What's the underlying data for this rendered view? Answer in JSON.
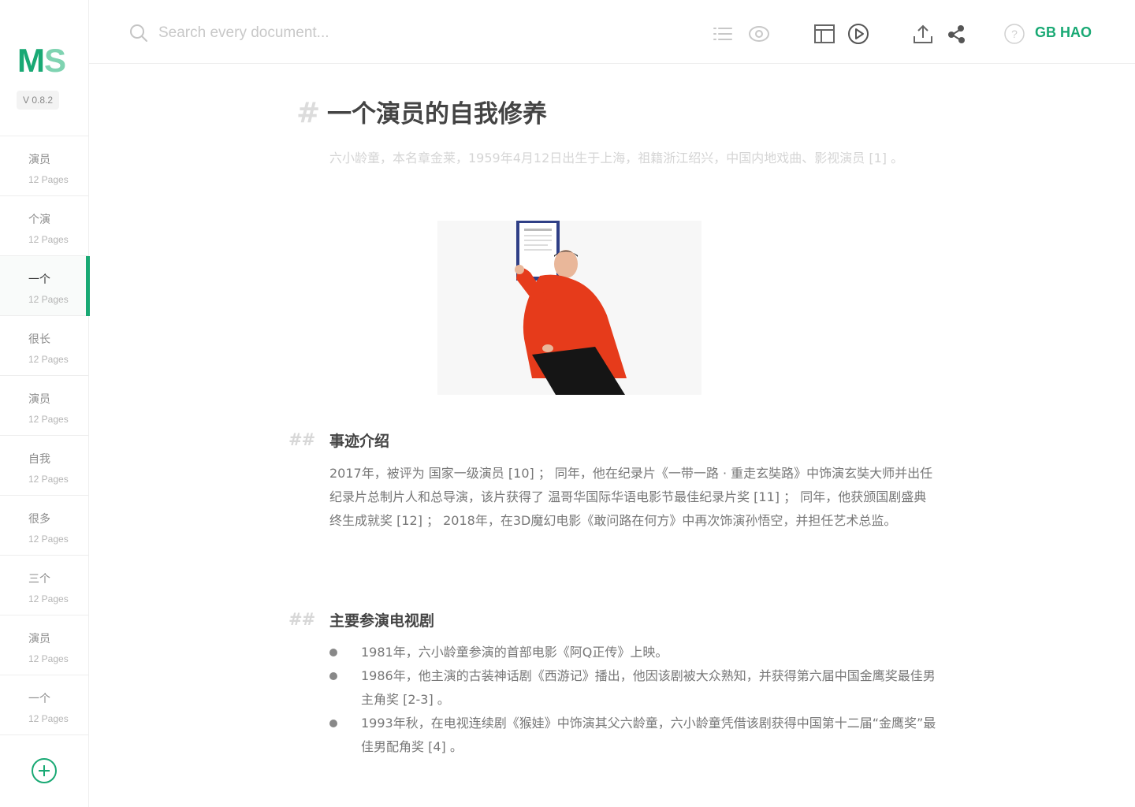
{
  "app": {
    "logo_m": "M",
    "logo_s": "S",
    "version": "V 0.8.2",
    "accent_color": "#19a974"
  },
  "sidebar": {
    "items": [
      {
        "title": "演员",
        "sub": "12 Pages"
      },
      {
        "title": "个演",
        "sub": "12 Pages"
      },
      {
        "title": "一个",
        "sub": "12 Pages",
        "active": true
      },
      {
        "title": "很长",
        "sub": "12 Pages"
      },
      {
        "title": "演员",
        "sub": "12 Pages"
      },
      {
        "title": "自我",
        "sub": "12 Pages"
      },
      {
        "title": "很多",
        "sub": "12 Pages"
      },
      {
        "title": "三个",
        "sub": "12 Pages"
      },
      {
        "title": "演员",
        "sub": "12 Pages"
      },
      {
        "title": "一个",
        "sub": "12 Pages"
      }
    ],
    "add_icon": "plus-circle-icon"
  },
  "toolbar": {
    "search_placeholder": "Search every document...",
    "icons": [
      "list-icon",
      "eye-icon",
      "layout-icon",
      "play-icon",
      "upload-icon",
      "share-icon",
      "help-icon"
    ],
    "user": "GB HAO"
  },
  "doc": {
    "h1_hash": "#",
    "title": "一个演员的自我修养",
    "intro": "六小龄童，本名章金莱，1959年4月12日出生于上海，祖籍浙江绍兴，中国内地戏曲、影视演员 [1] 。",
    "section1": {
      "hash": "##",
      "title": "事迹介绍",
      "paragraph": "2017年，被评为 国家一级演员 [10] ； 同年，他在纪录片《一带一路 · 重走玄奘路》中饰演玄奘大师并出任纪录片总制片人和总导演，该片获得了 温哥华国际华语电影节最佳纪录片奖 [11] ； 同年，他获颁国剧盛典 终生成就奖 [12] ； 2018年，在3D魔幻电影《敢问路在何方》中再次饰演孙悟空，并担任艺术总监。"
    },
    "section2": {
      "hash": "##",
      "title": "主要参演电视剧",
      "items": [
        "1981年，六小龄童参演的首部电影《阿Q正传》上映。",
        "1986年，他主演的古装神话剧《西游记》播出，他因该剧被大众熟知，并获得第六届中国金鹰奖最佳男主角奖 [2-3] 。",
        "1993年秋，在电视连续剧《猴娃》中饰演其父六龄童，六小龄童凭借该剧获得中国第十二届“金鹰奖”最佳男配角奖 [4] 。"
      ]
    }
  }
}
